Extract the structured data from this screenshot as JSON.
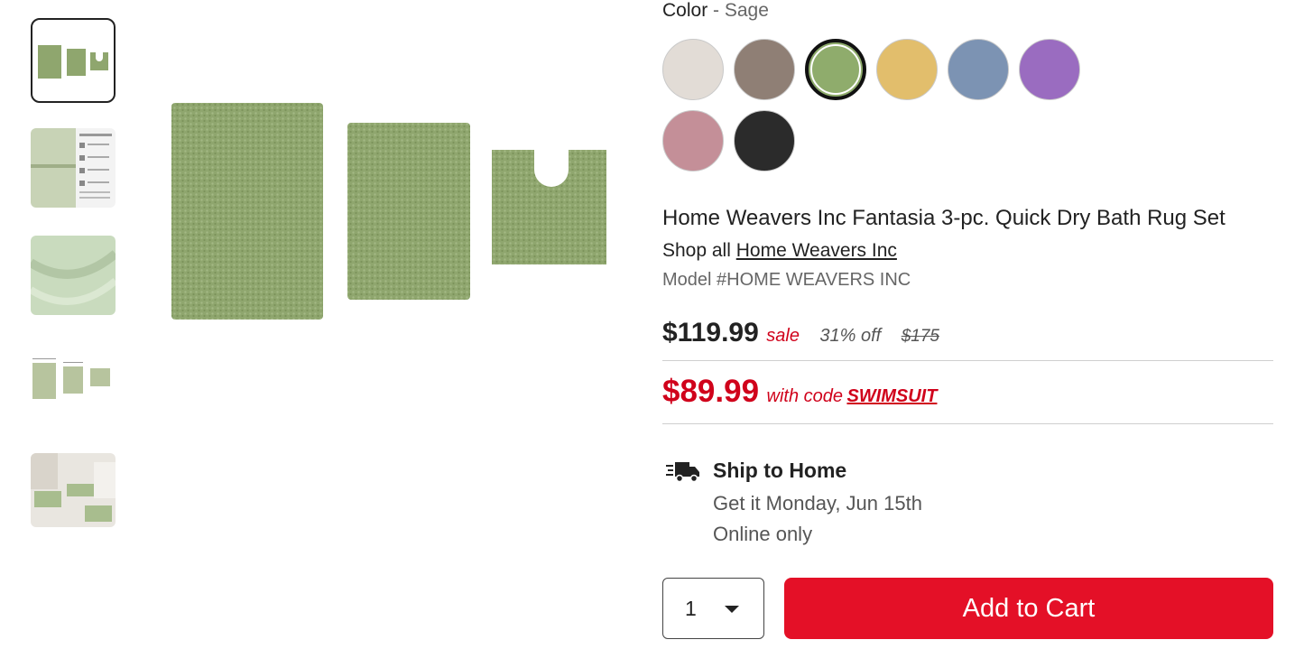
{
  "color": {
    "label": "Color",
    "separator": " - ",
    "selected": "Sage",
    "swatches": [
      {
        "name": "Ivory",
        "hex": "#e2dcd6"
      },
      {
        "name": "Mocha",
        "hex": "#8f7f75"
      },
      {
        "name": "Sage",
        "hex": "#8fac6c"
      },
      {
        "name": "Gold",
        "hex": "#e2be6c"
      },
      {
        "name": "Blue",
        "hex": "#7c93b3"
      },
      {
        "name": "Purple",
        "hex": "#9a6cc0"
      },
      {
        "name": "Rose",
        "hex": "#c48f98"
      },
      {
        "name": "Black",
        "hex": "#2b2b2b"
      }
    ]
  },
  "product": {
    "title": "Home Weavers Inc Fantasia 3-pc. Quick Dry Bath Rug Set",
    "shop_prefix": "Shop all",
    "brand": "Home Weavers Inc",
    "model": "Model #HOME WEAVERS INC"
  },
  "pricing": {
    "sale_price": "$119.99",
    "sale_label": "sale",
    "discount": "31% off",
    "original_price": "$175",
    "promo_price": "$89.99",
    "promo_text": "with code",
    "promo_code": "SWIMSUIT"
  },
  "shipping": {
    "title": "Ship to Home",
    "date": "Get it Monday, Jun 15th",
    "availability": "Online only"
  },
  "cart": {
    "quantity": "1",
    "add_label": "Add to Cart"
  },
  "colors": {
    "accent": "#e41027",
    "sale_red": "#d0021b",
    "rug_green": "#8fa66e"
  }
}
